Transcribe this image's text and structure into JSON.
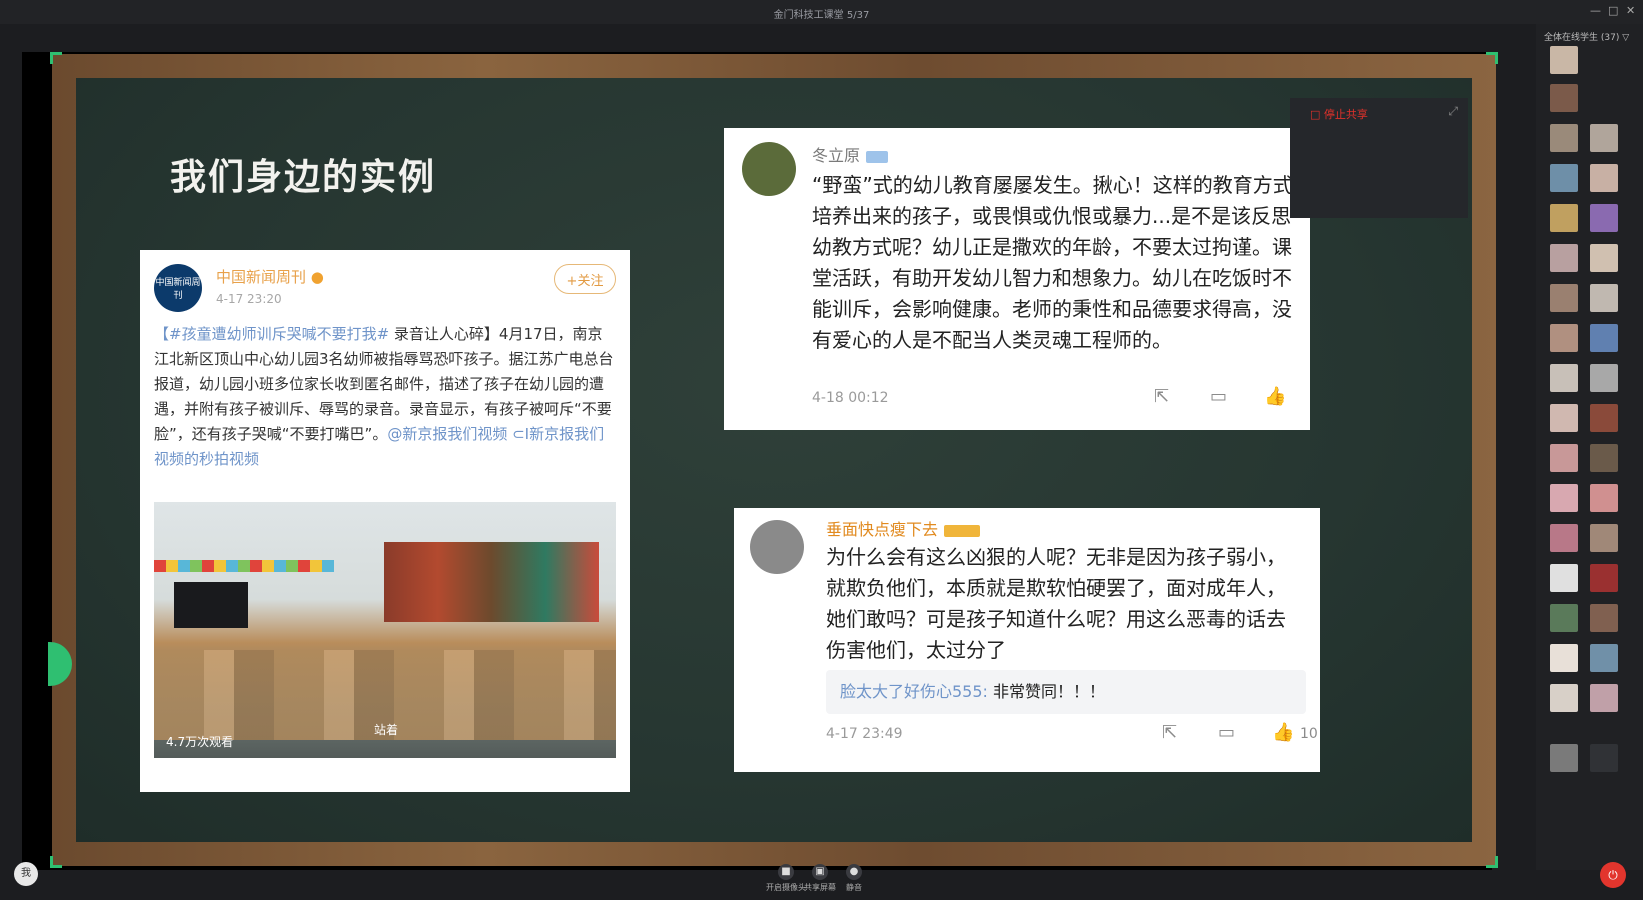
{
  "window": {
    "title": "金门科技工课堂 5/37"
  },
  "slide": {
    "title": "我们身边的实例",
    "weibo": {
      "avatar_text": "中国新闻周刊",
      "name": "中国新闻周刊",
      "time": "4-17 23:20",
      "follow_label": "+关注",
      "tag": "【#孩童遭幼师训斥哭喊不要打我#",
      "body": " 录音让人心碎】4月17日，南京江北新区顶山中心幼儿园3名幼师被指辱骂恐吓孩子。据江苏广电总台报道，幼儿园小班多位家长收到匿名邮件，描述了孩子在幼儿园的遭遇，并附有孩子被训斥、辱骂的录音。录音显示，有孩子被呵斥“不要脸”，还有孩子哭喊“不要打嘴巴”。",
      "link": "@新京报我们视频 ⊂I新京报我们视频的秒拍视频",
      "photo_caption_left": "4.7万次观看",
      "photo_caption_mid": "站着",
      "photo_views": ""
    },
    "comment1": {
      "name": "冬立原",
      "text": "“野蛮”式的幼儿教育屡屡发生。揪心！这样的教育方式培养出来的孩子，或畏惧或仇恨或暴力...是不是该反思幼教方式呢？幼儿正是撒欢的年龄，不要太过拘谨。课堂活跃，有助开发幼儿智力和想象力。幼儿在吃饭时不能训斥，会影响健康。老师的秉性和品德要求得高，没有爱心的人是不配当人类灵魂工程师的。",
      "time": "4-18 00:12"
    },
    "comment2": {
      "name": "垂面快点瘦下去",
      "text": "为什么会有这么凶狠的人呢？无非是因为孩子弱小，就欺负他们，本质就是欺软怕硬罢了，面对成年人，她们敢吗？可是孩子知道什么呢？用这么恶毒的话去伤害他们，太过分了",
      "reply_name": "脸太大了好伤心555:",
      "reply_text": " 非常赞同！！！",
      "time": "4-17 23:49",
      "likes": "10"
    }
  },
  "floating": {
    "rec_label": "□ 停止共享"
  },
  "sidebar": {
    "title": "全体在线学生 (37) ▽"
  },
  "bottom": {
    "me": "我",
    "btn1": "开启摄像头",
    "btn2": "共享屏幕",
    "btn3": "静音",
    "leave_label": "⏻"
  },
  "colors": {
    "board": "#263631",
    "frame": "#7a5636",
    "accent": "#2fbf71"
  }
}
